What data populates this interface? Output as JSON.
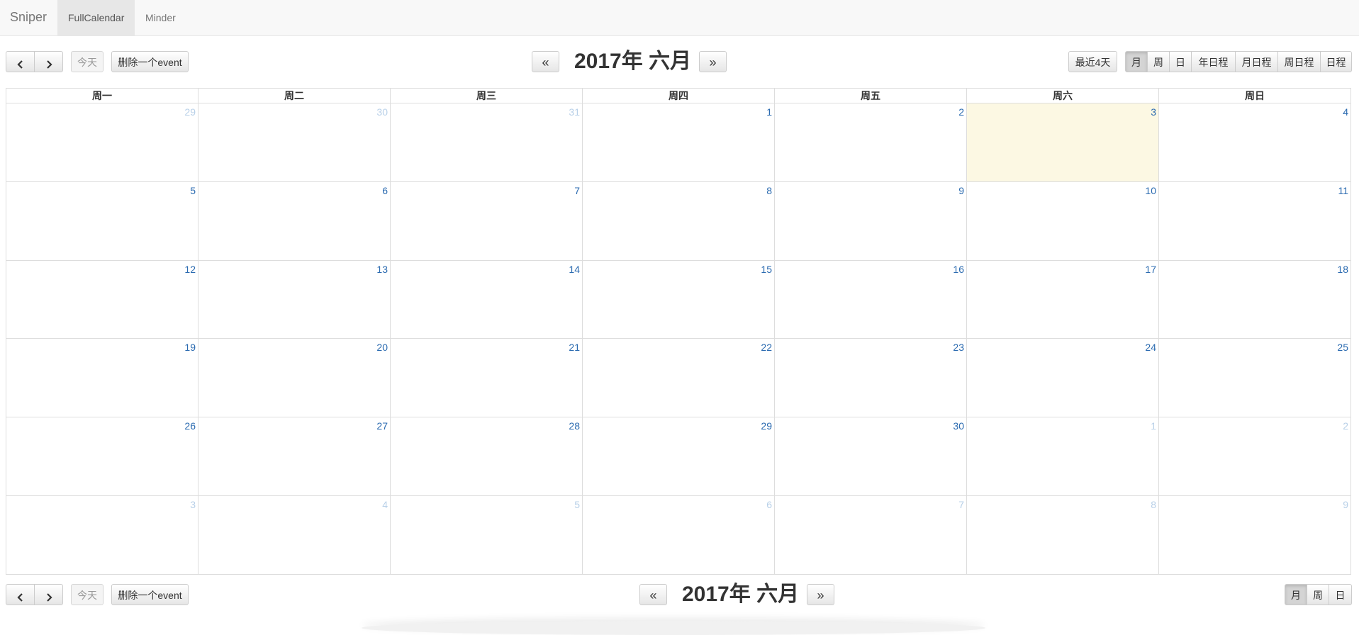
{
  "navbar": {
    "brand": "Sniper",
    "items": [
      {
        "label": "FullCalendar"
      },
      {
        "label": "Minder"
      }
    ]
  },
  "toolbar": {
    "prev_icon": "chevron-left-icon",
    "next_icon": "chevron-right-icon",
    "today_label": "今天",
    "delete_event_label": "删除一个event",
    "prev_year_label": "«",
    "next_year_label": "»",
    "title": "2017年 六月",
    "recent4_label": "最近4天",
    "views": [
      "月",
      "周",
      "日",
      "年日程",
      "月日程",
      "周日程",
      "日程"
    ],
    "active_view": "月"
  },
  "footer_toolbar": {
    "today_label": "今天",
    "delete_event_label": "删除一个event",
    "prev_year_label": "«",
    "next_year_label": "»",
    "title": "2017年 六月",
    "views": [
      "月",
      "周",
      "日"
    ],
    "active_view": "月"
  },
  "calendar": {
    "weekdays": [
      "周一",
      "周二",
      "周三",
      "周四",
      "周五",
      "周六",
      "周日"
    ],
    "today_date": "3",
    "weeks": [
      [
        "29",
        "30",
        "31",
        "1",
        "2",
        "3",
        "4"
      ],
      [
        "5",
        "6",
        "7",
        "8",
        "9",
        "10",
        "11"
      ],
      [
        "12",
        "13",
        "14",
        "15",
        "16",
        "17",
        "18"
      ],
      [
        "19",
        "20",
        "21",
        "22",
        "23",
        "24",
        "25"
      ],
      [
        "26",
        "27",
        "28",
        "29",
        "30",
        "1",
        "2"
      ],
      [
        "3",
        "4",
        "5",
        "6",
        "7",
        "8",
        "9"
      ]
    ]
  },
  "colors": {
    "current_month_day": "#2a6ab0",
    "other_month_day": "#b8d0e8",
    "today_bg": "#fcf8e3"
  }
}
